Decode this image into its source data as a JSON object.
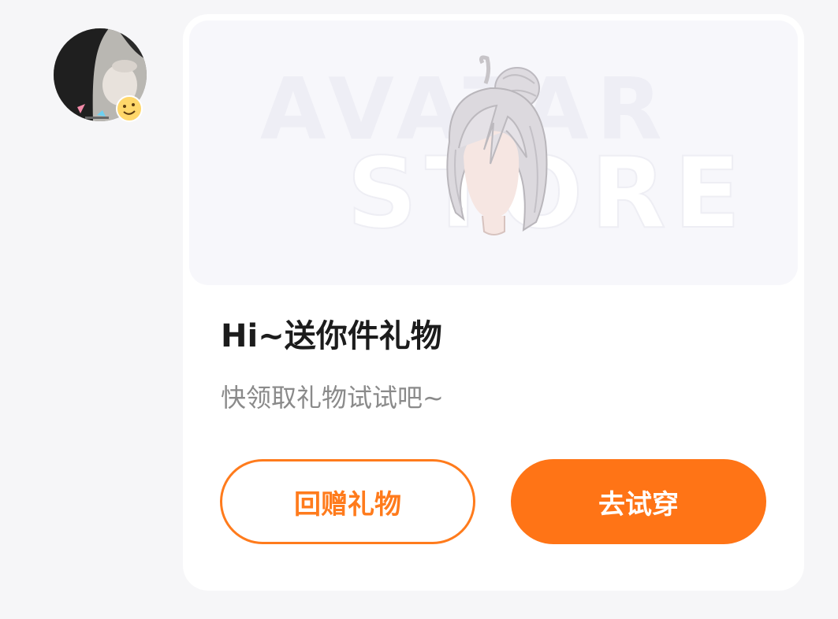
{
  "avatar": {
    "icon": "user-avatar-photo",
    "badge_icon": "emoji-face-badge"
  },
  "card": {
    "banner": {
      "line1": "AVATAR",
      "line2": "STORE",
      "image_icon": "hair-accessory-icon"
    },
    "title": "Hi~送你件礼物",
    "subtitle": "快领取礼物试试吧~",
    "buttons": {
      "return_gift": "回赠礼物",
      "try_on": "去试穿"
    }
  },
  "colors": {
    "accent": "#ff7416",
    "background": "#f6f6f8",
    "card": "#ffffff",
    "banner": "#f7f7fb"
  }
}
